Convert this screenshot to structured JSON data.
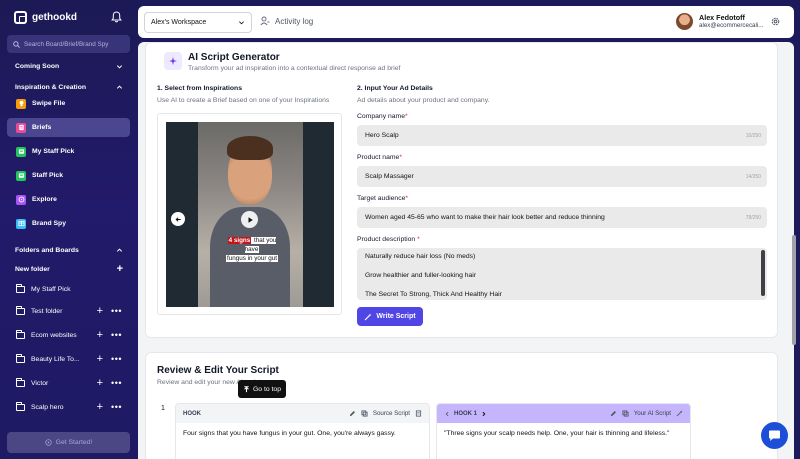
{
  "sidebar": {
    "logo_text": "gethookd",
    "search_placeholder": "Search Board/Brief/Brand Spy",
    "coming_soon": "Coming Soon",
    "inspiration_section": "Inspiration & Creation",
    "nav_items": [
      {
        "label": "Swipe File",
        "icon": "lightbulb-icon",
        "color": "#f59e0b",
        "active": false
      },
      {
        "label": "Briefs",
        "icon": "document-icon",
        "color": "#ec4899",
        "active": true
      },
      {
        "label": "My Staff Pick",
        "icon": "star-badge-icon",
        "color": "#22c55e",
        "active": false
      },
      {
        "label": "Staff Pick",
        "icon": "star-badge-icon",
        "color": "#22c55e",
        "active": false
      },
      {
        "label": "Explore",
        "icon": "compass-icon",
        "color": "#a855f7",
        "active": false
      },
      {
        "label": "Brand Spy",
        "icon": "table-icon",
        "color": "#38bdf8",
        "active": false
      }
    ],
    "folders_section": "Folders and Boards",
    "new_folder": "New folder",
    "folders": [
      {
        "label": "My Staff Pick",
        "actions": false
      },
      {
        "label": "Test folder",
        "actions": true
      },
      {
        "label": "Ecom websites",
        "actions": true
      },
      {
        "label": "Beauty Life To...",
        "actions": true
      },
      {
        "label": "Victor",
        "actions": true
      },
      {
        "label": "Scalp hero",
        "actions": true
      }
    ],
    "get_started": "Get Started!"
  },
  "topbar": {
    "workspace": "Alex's Workspace",
    "activity_log": "Activity log",
    "user_name": "Alex Fedotoff",
    "user_email": "alex@ecommercecali..."
  },
  "generator": {
    "title": "AI Script Generator",
    "subtitle": "Transform your ad inspiration into a contextual direct response ad brief",
    "step1_title": "1. Select from Inspirations",
    "step1_sub": "Use AI to create a Brief based on one of your Inspirations",
    "video_caption_highlight": "4 signs",
    "video_caption_rest1": " that you have",
    "video_caption_rest2": "fungus in your gut",
    "step2_title": "2. Input Your Ad Details",
    "step2_sub": "Ad details about your product and company.",
    "company_label": "Company name",
    "company_value": "Hero Scalp",
    "company_count": "10/250",
    "product_label": "Product name",
    "product_value": "Scalp Massager",
    "product_count": "14/250",
    "audience_label": "Target audience",
    "audience_value": "Women aged 45-65 who want to make their hair look better and reduce thinning",
    "audience_count": "78/250",
    "description_label": "Product description",
    "description_lines": [
      "Naturally reduce hair loss (No meds)",
      "Grow healthier and fuller-looking hair",
      "The Secret To Strong, Thick And Healthy Hair"
    ],
    "required_mark": "*",
    "write_script": "Write Script"
  },
  "review": {
    "title": "Review & Edit Your Script",
    "subtitle": "Review and edit your new AI script",
    "row_number": "1",
    "source_head": "HOOK",
    "source_label": "Source Script",
    "source_text": "Four signs that you have fungus in your gut. One, you're always gassy.",
    "ai_head": "HOOK 1",
    "ai_label": "Your AI Script",
    "ai_text": "\"Three signs your scalp needs help. One, your hair is thinning and lifeless.\"",
    "go_to_top": "Go to top"
  }
}
